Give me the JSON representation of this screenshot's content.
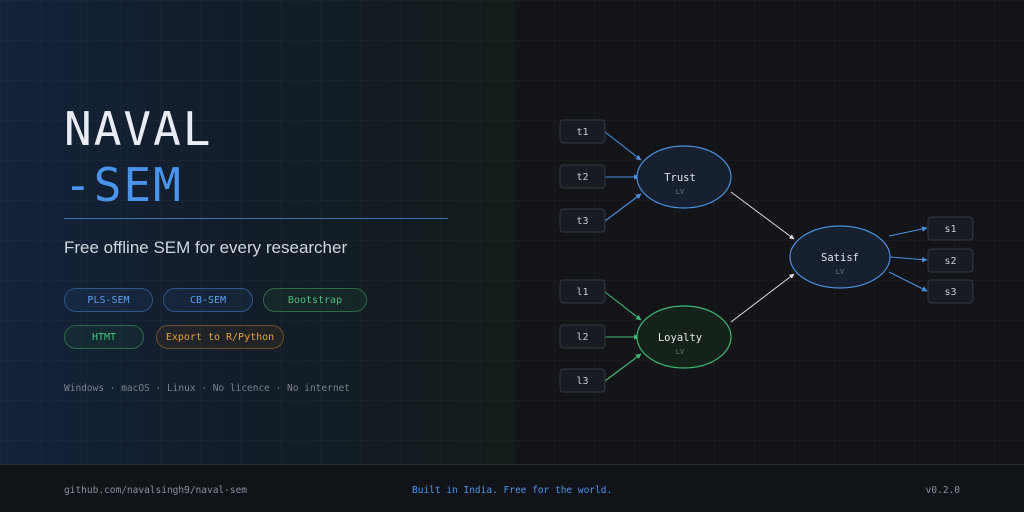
{
  "hero": {
    "title_line1": "NAVAL",
    "title_line2": "-SEM",
    "tagline": "Free offline SEM for every researcher",
    "chips": [
      "PLS-SEM",
      "CB-SEM",
      "Bootstrap",
      "HTMT",
      "Export to R/Python"
    ],
    "platforms": "Windows · macOS · Linux · No licence · No internet"
  },
  "diagram": {
    "indicators_trust": [
      "t1",
      "t2",
      "t3"
    ],
    "indicators_loyalty": [
      "l1",
      "l2",
      "l3"
    ],
    "indicators_satisf": [
      "s1",
      "s2",
      "s3"
    ],
    "latents": [
      {
        "name": "Trust",
        "tag": "LV"
      },
      {
        "name": "Loyalty",
        "tag": "LV"
      },
      {
        "name": "Satisf",
        "tag": "LV"
      }
    ]
  },
  "footer": {
    "repo": "github.com/navalsingh9/naval-sem",
    "slogan": "Built in India. Free for the world.",
    "version": "v0.2.0"
  },
  "colors": {
    "accent_blue": "#4a94ec",
    "accent_green": "#48c27e",
    "accent_orange": "#e6a03a",
    "background": "#0d1016"
  }
}
